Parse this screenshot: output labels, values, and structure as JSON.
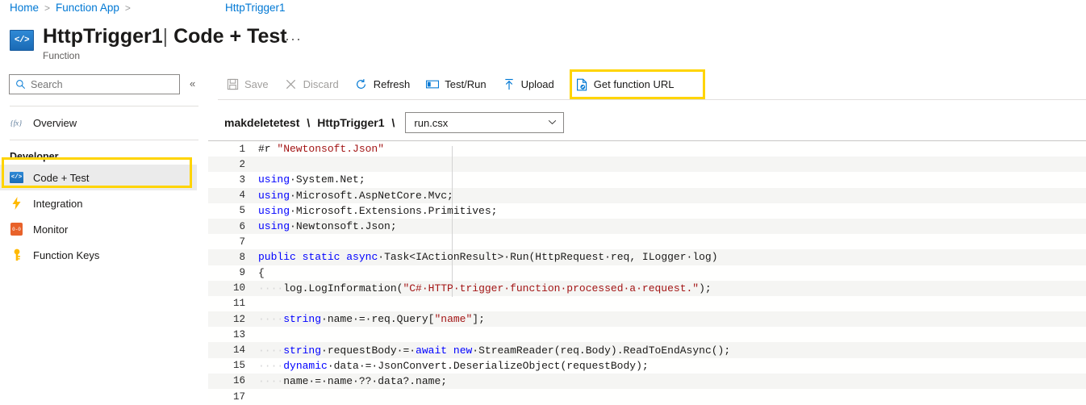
{
  "breadcrumb": {
    "items": [
      {
        "label": "Home",
        "name": "breadcrumb-home"
      },
      {
        "label": "Function App",
        "name": "breadcrumb-function-app"
      }
    ],
    "separator": ">",
    "current": "HttpTrigger1"
  },
  "header": {
    "icon": "function-code-icon",
    "title_main": "HttpTrigger1",
    "title_separator": "|",
    "title_section": "Code + Test",
    "subtitle": "Function",
    "more_menu": "···"
  },
  "sidebar": {
    "search": {
      "placeholder": "Search",
      "value": ""
    },
    "collapse_glyph": "«",
    "items": [
      {
        "label": "Overview",
        "icon": "fx-icon",
        "name": "sidebar-item-overview",
        "selected": false
      },
      {
        "label": "Code + Test",
        "icon": "code-test-icon",
        "name": "sidebar-item-code-test",
        "selected": true
      },
      {
        "label": "Integration",
        "icon": "lightning-bolt-icon",
        "name": "sidebar-item-integration",
        "selected": false
      },
      {
        "label": "Monitor",
        "icon": "monitor-icon",
        "name": "sidebar-item-monitor",
        "selected": false
      },
      {
        "label": "Function Keys",
        "icon": "key-icon",
        "name": "sidebar-item-function-keys",
        "selected": false
      }
    ],
    "section_developer": "Developer"
  },
  "toolbar": {
    "save": "Save",
    "discard": "Discard",
    "refresh": "Refresh",
    "test_run": "Test/Run",
    "upload": "Upload",
    "get_function_url": "Get function URL"
  },
  "pathbar": {
    "app": "makdeletetest",
    "separator": "\\",
    "function": "HttpTrigger1",
    "file_selected": "run.csx",
    "chevron": "∨"
  },
  "highlights": {
    "color": "#ffd400",
    "targets": [
      "sidebar-item-code-test",
      "get-function-url-button"
    ]
  },
  "editor": {
    "lines": [
      {
        "n": "1",
        "segments": [
          {
            "t": "#r ",
            "c": "plain"
          },
          {
            "t": "\"Newtonsoft.Json\"",
            "c": "str"
          }
        ]
      },
      {
        "n": "2",
        "segments": []
      },
      {
        "n": "3",
        "segments": [
          {
            "t": "using",
            "c": "kw"
          },
          {
            "t": "·System.Net;",
            "c": "plain"
          }
        ]
      },
      {
        "n": "4",
        "segments": [
          {
            "t": "using",
            "c": "kw"
          },
          {
            "t": "·Microsoft.AspNetCore.Mvc;",
            "c": "plain"
          }
        ]
      },
      {
        "n": "5",
        "segments": [
          {
            "t": "using",
            "c": "kw"
          },
          {
            "t": "·Microsoft.Extensions.Primitives;",
            "c": "plain"
          }
        ]
      },
      {
        "n": "6",
        "segments": [
          {
            "t": "using",
            "c": "kw"
          },
          {
            "t": "·Newtonsoft.Json;",
            "c": "plain"
          }
        ]
      },
      {
        "n": "7",
        "segments": []
      },
      {
        "n": "8",
        "segments": [
          {
            "t": "public",
            "c": "kw"
          },
          {
            "t": " ",
            "c": "plain"
          },
          {
            "t": "static",
            "c": "kw"
          },
          {
            "t": " ",
            "c": "plain"
          },
          {
            "t": "async",
            "c": "kw"
          },
          {
            "t": "·Task<IActionResult>·Run(HttpRequest·req, ILogger·log)",
            "c": "plain"
          }
        ]
      },
      {
        "n": "9",
        "segments": [
          {
            "t": "{",
            "c": "plain"
          }
        ]
      },
      {
        "n": "10",
        "segments": [
          {
            "t": "····",
            "c": "dot"
          },
          {
            "t": "log.LogInformation(",
            "c": "plain"
          },
          {
            "t": "\"C#·HTTP·trigger·function·processed·a·request.\"",
            "c": "str"
          },
          {
            "t": ");",
            "c": "plain"
          }
        ]
      },
      {
        "n": "11",
        "segments": []
      },
      {
        "n": "12",
        "segments": [
          {
            "t": "····",
            "c": "dot"
          },
          {
            "t": "string",
            "c": "kw"
          },
          {
            "t": "·name·=·req.Query[",
            "c": "plain"
          },
          {
            "t": "\"name\"",
            "c": "str"
          },
          {
            "t": "];",
            "c": "plain"
          }
        ]
      },
      {
        "n": "13",
        "segments": []
      },
      {
        "n": "14",
        "segments": [
          {
            "t": "····",
            "c": "dot"
          },
          {
            "t": "string",
            "c": "kw"
          },
          {
            "t": "·requestBody·=·",
            "c": "plain"
          },
          {
            "t": "await",
            "c": "kw"
          },
          {
            "t": " ",
            "c": "plain"
          },
          {
            "t": "new",
            "c": "kw"
          },
          {
            "t": "·StreamReader(req.Body).ReadToEndAsync();",
            "c": "plain"
          }
        ]
      },
      {
        "n": "15",
        "segments": [
          {
            "t": "····",
            "c": "dot"
          },
          {
            "t": "dynamic",
            "c": "kw"
          },
          {
            "t": "·data·=·JsonConvert.DeserializeObject(requestBody);",
            "c": "plain"
          }
        ]
      },
      {
        "n": "16",
        "segments": [
          {
            "t": "····",
            "c": "dot"
          },
          {
            "t": "name·=·name·??·data?.name;",
            "c": "plain"
          }
        ]
      },
      {
        "n": "17",
        "segments": []
      }
    ]
  }
}
